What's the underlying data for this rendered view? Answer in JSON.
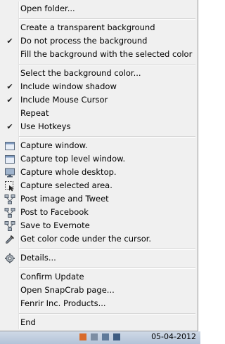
{
  "menu": {
    "open_folder": "Open folder...",
    "create_transparent": "Create a transparent background",
    "do_not_process": "Do not process the background",
    "fill_background": "Fill the background with the selected color",
    "select_bg_color": "Select the background color...",
    "include_shadow": "Include window shadow",
    "include_cursor": "Include Mouse Cursor",
    "repeat": "Repeat",
    "use_hotkeys": "Use Hotkeys",
    "capture_window": "Capture window.",
    "capture_top_level": "Capture top level window.",
    "capture_desktop": "Capture whole desktop.",
    "capture_area": "Capture selected area.",
    "post_tweet": "Post image and Tweet",
    "post_facebook": "Post to Facebook",
    "save_evernote": "Save to Evernote",
    "get_color": "Get color code under the cursor.",
    "details": "Details...",
    "confirm_update": "Confirm Update",
    "open_page": "Open SnapCrab page...",
    "fenrir_products": "Fenrir Inc. Products...",
    "end": "End"
  },
  "checks": {
    "do_not_process": true,
    "include_shadow": true,
    "include_cursor": true,
    "use_hotkeys": true
  },
  "icons": {
    "capture_window": "window-icon",
    "capture_top_level": "window-icon",
    "capture_desktop": "monitor-icon",
    "capture_area": "selection-icon",
    "post_tweet": "share-icon",
    "post_facebook": "share-icon",
    "save_evernote": "share-icon",
    "get_color": "eyedropper-icon",
    "details": "gear-icon"
  },
  "taskbar": {
    "date": "05-04-2012"
  }
}
